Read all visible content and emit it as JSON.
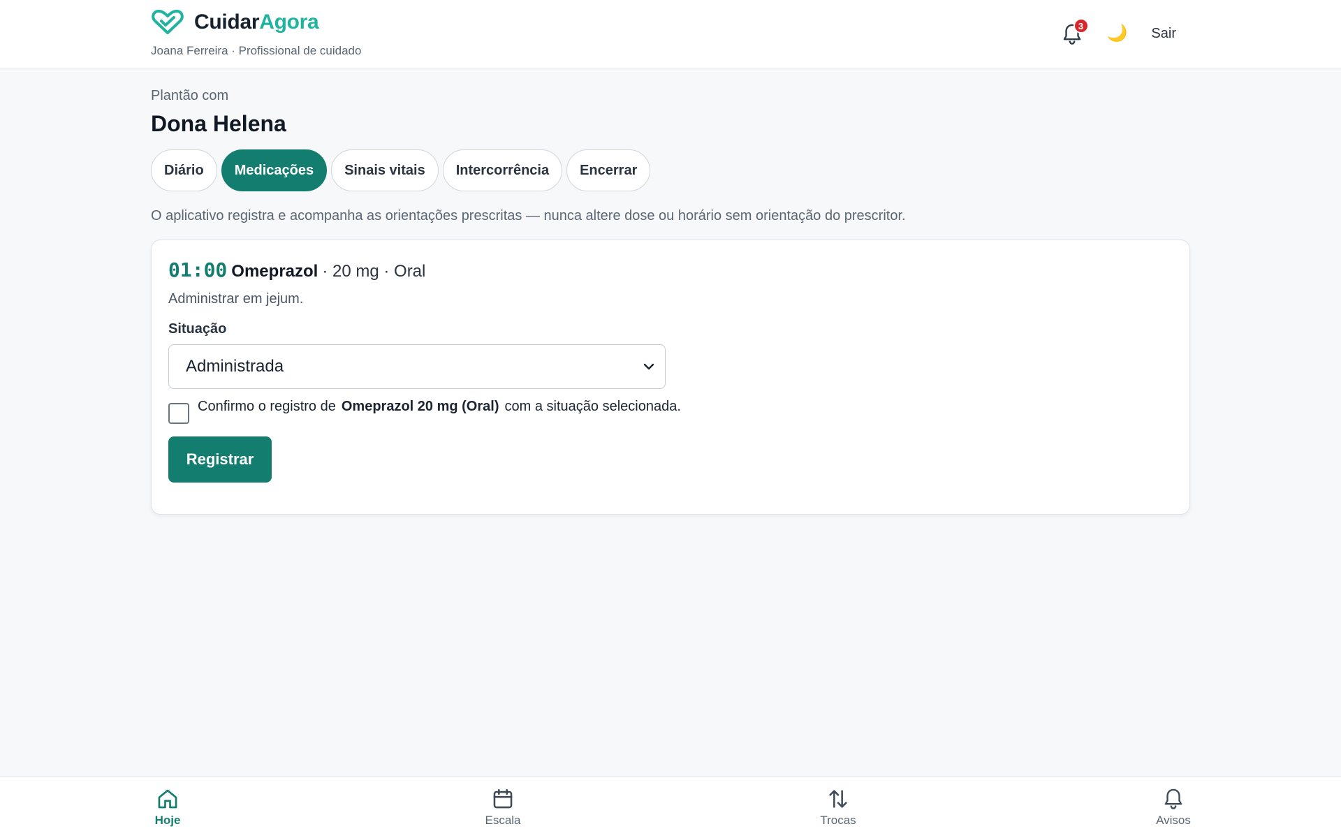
{
  "header": {
    "brand_part1": "Cuidar",
    "brand_part2": "Agora",
    "user_line": "Joana Ferreira · Profissional de cuidado",
    "notification_count": "3",
    "theme_icon": "🌙",
    "logout_label": "Sair"
  },
  "shift": {
    "label": "Plantão com",
    "patient_name": "Dona Helena"
  },
  "tabs": [
    {
      "label": "Diário",
      "active": false
    },
    {
      "label": "Medicações",
      "active": true
    },
    {
      "label": "Sinais vitais",
      "active": false
    },
    {
      "label": "Intercorrência",
      "active": false
    },
    {
      "label": "Encerrar",
      "active": false
    }
  ],
  "notice": "O aplicativo registra e acompanha as orientações prescritas — nunca altere dose ou horário sem orientação do prescritor.",
  "medication": {
    "time": "01:00",
    "name": "Omeprazol",
    "detail": "· 20 mg · Oral",
    "instructions": "Administrar em jejum.",
    "status_label": "Situação",
    "status_value": "Administrada",
    "confirm_prefix": "Confirmo o registro de",
    "confirm_strong": "Omeprazol 20 mg (Oral)",
    "confirm_suffix": "com a situação selecionada.",
    "confirmed": false,
    "register_label": "Registrar"
  },
  "bottom_nav": [
    {
      "label": "Hoje",
      "icon": "home-icon",
      "active": true
    },
    {
      "label": "Escala",
      "icon": "calendar-icon",
      "active": false
    },
    {
      "label": "Trocas",
      "icon": "swap-arrows-icon",
      "active": false
    },
    {
      "label": "Avisos",
      "icon": "bell-icon",
      "active": false
    }
  ],
  "colors": {
    "primary": "#137e70",
    "brand_accent": "#1fb3a0",
    "badge": "#d7262c",
    "background": "#f6f8fa"
  }
}
